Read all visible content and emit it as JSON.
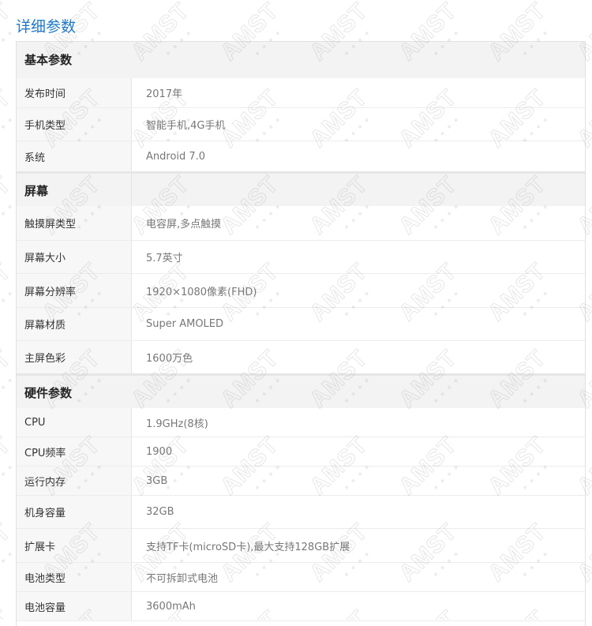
{
  "page_title": "详细参数",
  "groups": [
    {
      "title": "基本参数",
      "rows": [
        {
          "key": "发布时间",
          "value": "2017年"
        },
        {
          "key": "手机类型",
          "value": "智能手机,4G手机"
        },
        {
          "key": "系统",
          "value": "Android 7.0"
        }
      ]
    },
    {
      "title": "屏幕",
      "rows": [
        {
          "key": "触摸屏类型",
          "value": "电容屏,多点触摸"
        },
        {
          "key": "屏幕大小",
          "value": "5.7英寸"
        },
        {
          "key": "屏幕分辨率",
          "value": "1920×1080像素(FHD)"
        },
        {
          "key": "屏幕材质",
          "value": "Super AMOLED"
        },
        {
          "key": "主屏色彩",
          "value": "1600万色"
        }
      ]
    },
    {
      "title": "硬件参数",
      "rows": [
        {
          "key": "CPU",
          "value": "1.9GHz(8核)"
        },
        {
          "key": "CPU频率",
          "value": "1900"
        },
        {
          "key": "运行内存",
          "value": "3GB"
        },
        {
          "key": "机身容量",
          "value": "32GB"
        },
        {
          "key": "扩展卡",
          "value": "支持TF卡(microSD卡),最大支持128GB扩展"
        },
        {
          "key": "电池类型",
          "value": "不可拆卸式电池"
        },
        {
          "key": "电池容量",
          "value": "3600mAh"
        }
      ]
    }
  ],
  "watermark_text": "AMST",
  "colors": {
    "title": "#1f78c8",
    "header_bg": "#f3f3f3",
    "key_bg": "#f7f7f7",
    "border": "#e4e4e4"
  }
}
